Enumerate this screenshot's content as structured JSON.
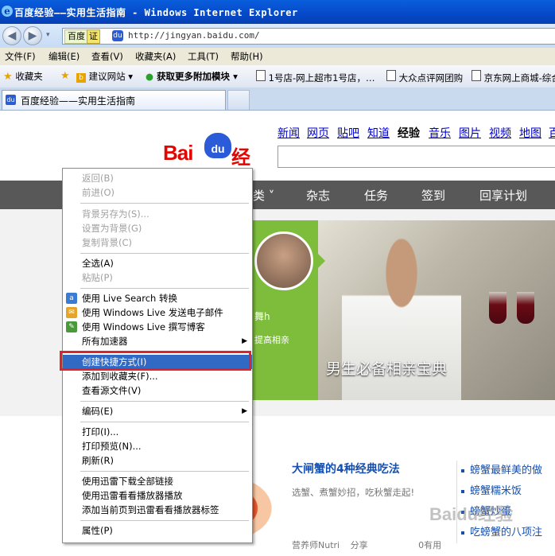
{
  "window": {
    "title": "百度经验——实用生活指南 - Windows Internet Explorer"
  },
  "address": {
    "badge": "百度",
    "cert": "证",
    "url": "http://jingyan.baidu.com/"
  },
  "menu": [
    "文件(F)",
    "编辑(E)",
    "查看(V)",
    "收藏夹(A)",
    "工具(T)",
    "帮助(H)"
  ],
  "favorites": {
    "label": "收藏夹",
    "items": [
      "建议网站 ▾",
      "获取更多附加模块 ▾",
      "1号店-网上超市1号店，…",
      "大众点评网团购",
      "京东网上商城-综合"
    ]
  },
  "tab": {
    "title": "百度经验——实用生活指南"
  },
  "page": {
    "toplinks": [
      "新闻",
      "网页",
      "贴吧",
      "知道",
      "经验",
      "音乐",
      "图片",
      "视频",
      "地图",
      "百"
    ],
    "logo": {
      "bai": "Bai",
      "du": "du",
      "jy": "经验"
    },
    "nav": [
      "类 ˅",
      "杂志",
      "任务",
      "签到",
      "回享计划"
    ],
    "banner": {
      "caption": "男生必备相亲宝典"
    },
    "green": {
      "name": "舞h",
      "desc": "提高相亲"
    },
    "article": {
      "title": "大闸蟹的4种经典吃法",
      "subtitle": "选蟹、煮蟹妙招，吃秋蟹走起!",
      "author": "营养师Nutri",
      "share": "分享",
      "useful": "0有用"
    },
    "rightlist": [
      "螃蟹最鲜美的做",
      "螃蟹糯米饭",
      "螃蟹炒蛋",
      "吃螃蟹的八项注"
    ],
    "watermark": "Baidu经验"
  },
  "context_menu": {
    "items": [
      {
        "label": "返回(B)",
        "disabled": true
      },
      {
        "label": "前进(O)",
        "disabled": true
      },
      {
        "label": "背景另存为(S)...",
        "disabled": true
      },
      {
        "label": "设置为背景(G)",
        "disabled": true
      },
      {
        "label": "复制背景(C)",
        "disabled": true
      },
      {
        "label": "全选(A)",
        "disabled": false
      },
      {
        "label": "粘贴(P)",
        "disabled": true
      },
      {
        "label": "使用 Live Search 转换",
        "disabled": false
      },
      {
        "label": "使用 Windows Live 发送电子邮件",
        "disabled": false
      },
      {
        "label": "使用 Windows Live 撰写博客",
        "disabled": false
      },
      {
        "label": "所有加速器",
        "disabled": false
      },
      {
        "label": "创建快捷方式(I)",
        "disabled": false,
        "highlighted": true
      },
      {
        "label": "添加到收藏夹(F)...",
        "disabled": false
      },
      {
        "label": "查看源文件(V)",
        "disabled": false
      },
      {
        "label": "编码(E)",
        "disabled": false
      },
      {
        "label": "打印(I)...",
        "disabled": false
      },
      {
        "label": "打印预览(N)...",
        "disabled": false
      },
      {
        "label": "刷新(R)",
        "disabled": false
      },
      {
        "label": "使用迅雷下载全部链接",
        "disabled": false
      },
      {
        "label": "使用迅雷看看播放器播放",
        "disabled": false
      },
      {
        "label": "添加当前页到迅雷看看播放器标签",
        "disabled": false
      },
      {
        "label": "属性(P)",
        "disabled": false
      }
    ]
  },
  "colors": {
    "highlight": "#316ac5",
    "annotation": "#e0222a",
    "nav_bg": "#585858",
    "green": "#7dbd3b"
  }
}
